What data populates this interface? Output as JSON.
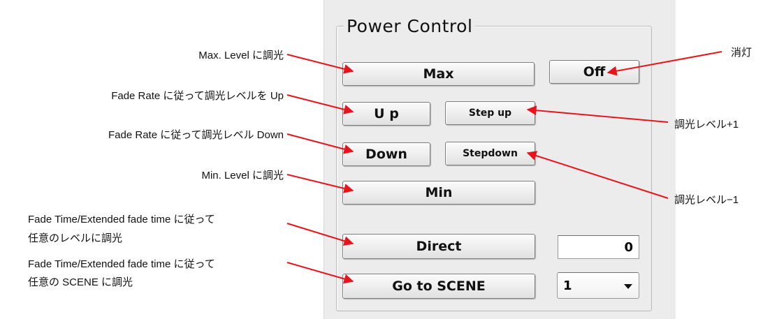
{
  "group": {
    "title": "Power Control"
  },
  "buttons": {
    "max": "Max",
    "off": "Off",
    "up": "U p",
    "step_up": "Step up",
    "down": "Down",
    "step_down": "Stepdown",
    "min": "Min",
    "direct": "Direct",
    "go_to_scene": "Go to SCENE"
  },
  "fields": {
    "direct_level": "0",
    "scene_select": "1"
  },
  "annotations": {
    "max": "Max. Level に調光",
    "off": "消灯",
    "up": "Fade Rate に従って調光レベルを Up",
    "step_up": "調光レベル+1",
    "down": "Fade Rate に従って調光レベル Down",
    "step_down": "調光レベル−1",
    "min": "Min. Level に調光",
    "direct_line1": "Fade Time/Extended fade time に従って",
    "direct_line2": "任意のレベルに調光",
    "scene_line1": "Fade Time/Extended fade time に従って",
    "scene_line2": "任意の SCENE に調光"
  },
  "colors": {
    "arrow": "#e8141c",
    "panel": "#ececec"
  }
}
